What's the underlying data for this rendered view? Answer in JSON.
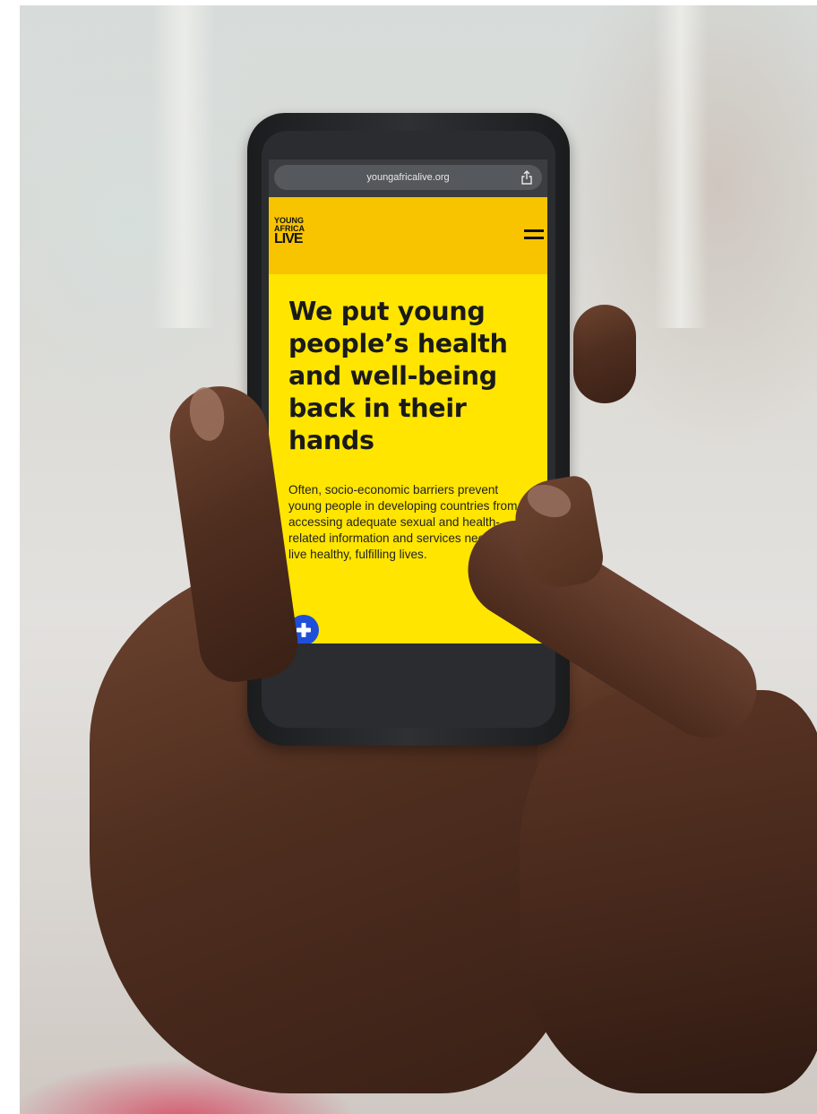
{
  "browser": {
    "url": "youngafricalive.org",
    "share_icon": "share-icon"
  },
  "site": {
    "logo_text_line1": "YOUNG",
    "logo_text_line2": "AFRICA",
    "logo_text_line3": "LIVE",
    "menu_icon": "hamburger-menu-icon",
    "header_color": "#f8c400",
    "hero_color": "#ffe500"
  },
  "hero": {
    "title": "We put young people’s health and well-being back in their hands",
    "body": "Often, socio-economic barriers prevent young people in developing countries from accessing adequate sexual and health-related information and services needed to live healthy, fulfilling lives.",
    "plus_icon": "plus-icon",
    "plus_color": "#1f4fd8"
  }
}
